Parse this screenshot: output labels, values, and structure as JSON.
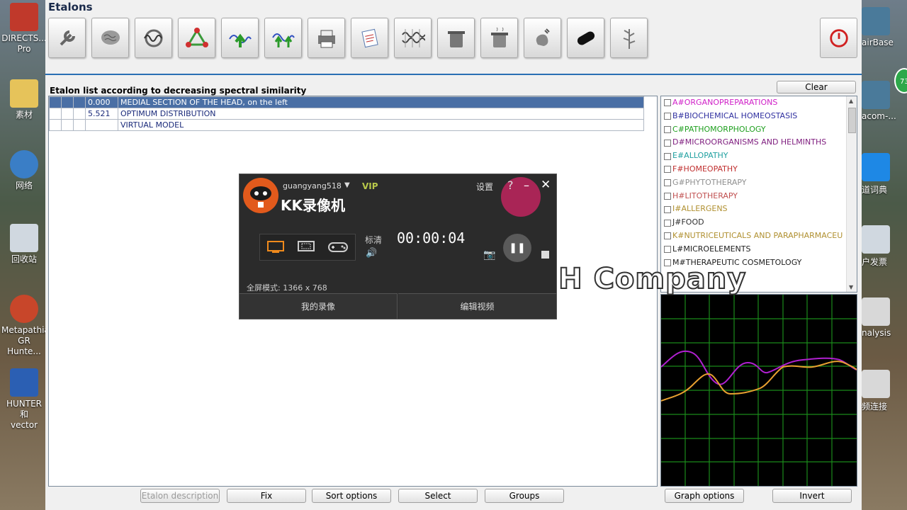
{
  "desktop": {
    "left_icons": [
      {
        "label": "DIRECTS...\nPro",
        "color": "#c0392b"
      },
      {
        "label": "素材",
        "color": "#e6c35a"
      },
      {
        "label": "网络",
        "color": "#3a7ec6"
      },
      {
        "label": "回收站",
        "color": "#d0d8e0"
      },
      {
        "label": "Metapathia\nGR Hunte...",
        "color": "#c8462a"
      },
      {
        "label": "HUNTER 和\nvector",
        "color": "#2b5fb3"
      }
    ],
    "right_icons": [
      {
        "label": "airBase",
        "color": "#4a7a9a"
      },
      {
        "label": "acom-...",
        "color": "#4a7a9a"
      },
      {
        "label": "道词典",
        "color": "#1e88e5"
      },
      {
        "label": "户发票",
        "color": "#d0d8e0"
      },
      {
        "label": "nalysis",
        "color": "#d8d8d8"
      },
      {
        "label": "频连接",
        "color": "#d8d8d8"
      }
    ],
    "badge": "73"
  },
  "app": {
    "title": "Etalons",
    "toolbar_icons": [
      "wrench-icon",
      "brain-icon",
      "wave-cycle-icon",
      "triangle-nodes-icon",
      "spectrum-up-icon",
      "spectrum-dual-icon",
      "printer-icon",
      "notes-icon",
      "waveforms-icon",
      "pot-icon",
      "pot-steam-icon",
      "organ-icon",
      "capsule-icon",
      "herb-icon"
    ]
  },
  "etalon_list": {
    "header": "Etalon list according to decreasing spectral similarity",
    "clear_label": "Clear",
    "rows": [
      {
        "value": "0.000",
        "name": "MEDIAL SECTION OF THE HEAD, on the left",
        "selected": true
      },
      {
        "value": "5.521",
        "name": "OPTIMUM DISTRIBUTION",
        "selected": false
      },
      {
        "value": "",
        "name": "VIRTUAL MODEL",
        "selected": false
      }
    ]
  },
  "bottom_buttons": {
    "etalon_description": "Etalon description",
    "fix": "Fix",
    "sort_options": "Sort options",
    "select": "Select",
    "groups": "Groups"
  },
  "categories": [
    {
      "letter": "A",
      "name": "ORGANOPREPARATIONS",
      "color": "#d020c8"
    },
    {
      "letter": "B",
      "name": "BIOCHEMICAL HOMEOSTASIS",
      "color": "#3030a0"
    },
    {
      "letter": "C",
      "name": "PATHOMORPHOLOGY",
      "color": "#20a020"
    },
    {
      "letter": "D",
      "name": "MICROORGANISMS AND HELMINTHS",
      "color": "#802080"
    },
    {
      "letter": "E",
      "name": "ALLOPATHY",
      "color": "#20a0a0"
    },
    {
      "letter": "F",
      "name": "HOMEOPATHY",
      "color": "#c03030"
    },
    {
      "letter": "G",
      "name": "PHYTOTHERAPY",
      "color": "#909090"
    },
    {
      "letter": "H",
      "name": "LITOTHERAPY",
      "color": "#c05050"
    },
    {
      "letter": "I",
      "name": "ALLERGENS",
      "color": "#b09030"
    },
    {
      "letter": "J",
      "name": "FOOD",
      "color": "#303030"
    },
    {
      "letter": "K",
      "name": "NUTRICEUTICALS AND PARAPHARMACEU",
      "color": "#b09030"
    },
    {
      "letter": "L",
      "name": "MICROELEMENTS",
      "color": "#202020"
    },
    {
      "letter": "M",
      "name": "THERAPEUTIC COSMETOLOGY",
      "color": "#202020"
    }
  ],
  "graph_buttons": {
    "graph_options": "Graph options",
    "invert": "Invert"
  },
  "watermark": "SSCH Company",
  "recorder": {
    "user": "guangyang518",
    "vip": "VIP",
    "brand": "KK录像机",
    "settings": "设置",
    "help": "?",
    "minimize": "–",
    "close": "✕",
    "quality": "标清",
    "timer": "00:00:04",
    "fullscreen": "全屏模式: 1366 x 768",
    "tab_my_videos": "我的录像",
    "tab_edit_video": "编辑视频"
  }
}
